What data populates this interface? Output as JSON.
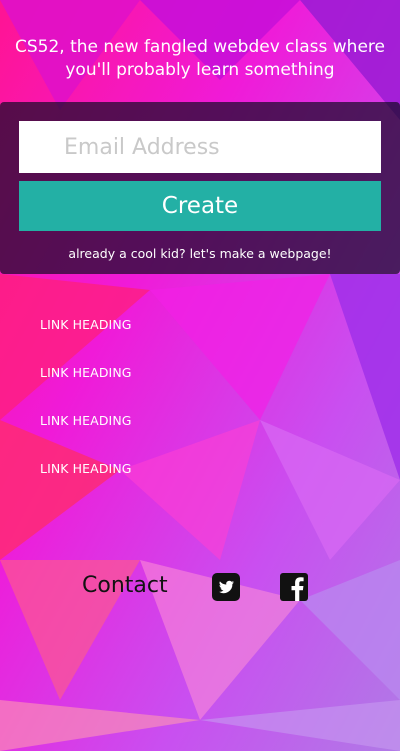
{
  "header": {
    "tagline": "CS52, the new fangled webdev class where you'll probably learn something"
  },
  "signup": {
    "email_placeholder": "Email Address",
    "create_label": "Create",
    "login_link": "already a cool kid? let's make a webpage!"
  },
  "links": [
    {
      "label": "LINK HEADING"
    },
    {
      "label": "LINK HEADING"
    },
    {
      "label": "LINK HEADING"
    },
    {
      "label": "LINK HEADING"
    }
  ],
  "footer": {
    "contact_label": "Contact",
    "social_icons": [
      "twitter-icon",
      "facebook-icon"
    ]
  },
  "colors": {
    "accent": "#23b0a5",
    "panel": "#180a28",
    "background": [
      "#ff1a8c",
      "#e61fe0",
      "#a33bf2"
    ]
  }
}
